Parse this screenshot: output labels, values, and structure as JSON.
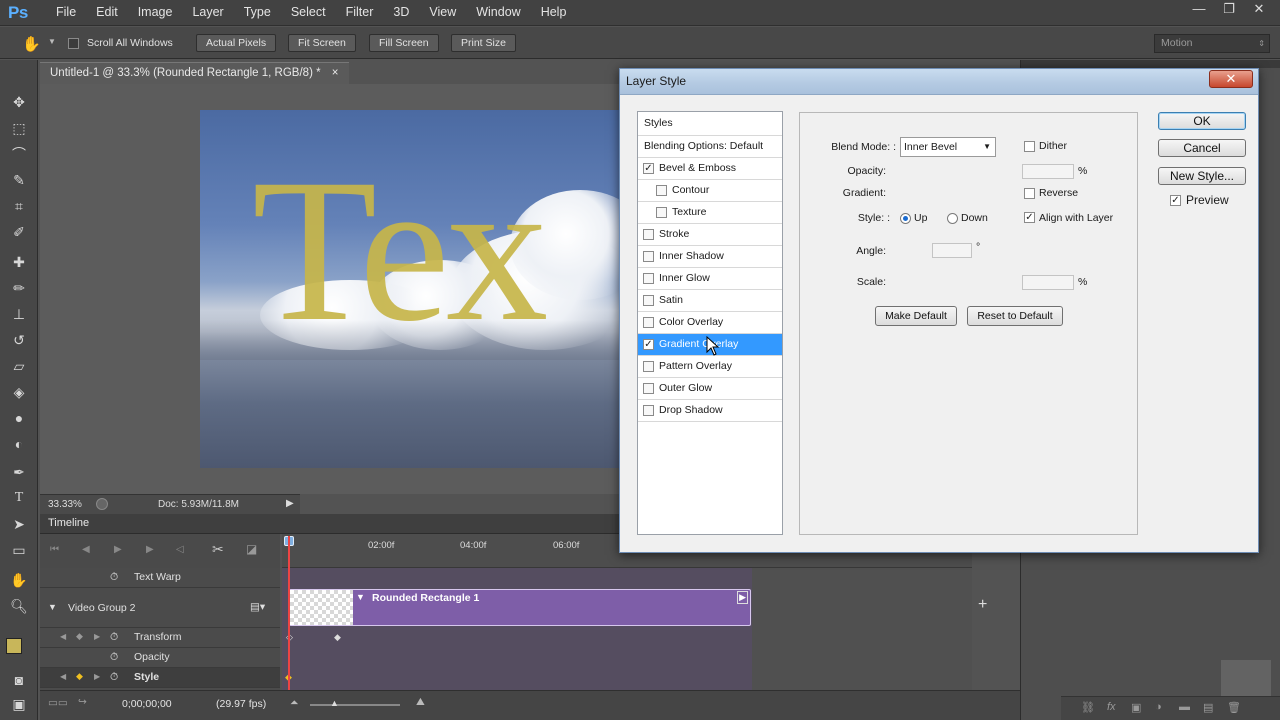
{
  "app": {
    "logo": "Ps",
    "menu": [
      "File",
      "Edit",
      "Image",
      "Layer",
      "Type",
      "Select",
      "Filter",
      "3D",
      "View",
      "Window",
      "Help"
    ],
    "window_controls": {
      "minimize": "—",
      "restore": "❐",
      "close": "✕"
    }
  },
  "options_bar": {
    "scroll_all_windows": "Scroll All Windows",
    "actual_pixels": "Actual Pixels",
    "fit_screen": "Fit Screen",
    "fill_screen": "Fill Screen",
    "print_size": "Print Size",
    "workspace": "Motion"
  },
  "document": {
    "tab_title": "Untitled-1 @ 33.3% (Rounded Rectangle 1, RGB/8) *",
    "tab_close": "×",
    "canvas_text": "Tex",
    "zoom": "33.33%",
    "doc_size": "Doc: 5.93M/11.8M"
  },
  "timeline": {
    "title": "Timeline",
    "ruler": [
      "02:00f",
      "04:00f",
      "06:00f"
    ],
    "rows": {
      "text_warp": "Text Warp",
      "video_group": "Video Group 2",
      "transform": "Transform",
      "opacity": "Opacity",
      "style": "Style"
    },
    "clip_label": "Rounded Rectangle 1",
    "timecode": "0;00;00;00",
    "fps": "(29.97 fps)"
  },
  "dialog": {
    "title": "Layer Style",
    "close": "✕",
    "styles_header": "Styles",
    "blending_options": "Blending Options: Default",
    "style_items": [
      {
        "label": "Bevel & Emboss",
        "checked": true
      },
      {
        "label": "Contour",
        "checked": false
      },
      {
        "label": "Texture",
        "checked": false
      },
      {
        "label": "Stroke",
        "checked": false
      },
      {
        "label": "Inner Shadow",
        "checked": false
      },
      {
        "label": "Inner Glow",
        "checked": false
      },
      {
        "label": "Satin",
        "checked": false
      },
      {
        "label": "Color Overlay",
        "checked": false
      },
      {
        "label": "Gradient Overlay",
        "checked": true,
        "selected": true
      },
      {
        "label": "Pattern Overlay",
        "checked": false
      },
      {
        "label": "Outer Glow",
        "checked": false
      },
      {
        "label": "Drop Shadow",
        "checked": false
      }
    ],
    "settings": {
      "blend_mode_label": "Blend Mode: :",
      "blend_mode_value": "Inner Bevel",
      "dither": "Dither",
      "opacity_label": "Opacity:",
      "opacity_unit": "%",
      "gradient_label": "Gradient:",
      "reverse": "Reverse",
      "style_label": "Style: :",
      "up": "Up",
      "down": "Down",
      "align_with_layer": "Align with Layer",
      "angle_label": "Angle:",
      "angle_unit": "°",
      "scale_label": "Scale:",
      "scale_unit": "%",
      "make_default": "Make Default",
      "reset_to_default": "Reset to Default"
    },
    "buttons": {
      "ok": "OK",
      "cancel": "Cancel",
      "new_style": "New Style...",
      "preview": "Preview"
    }
  }
}
